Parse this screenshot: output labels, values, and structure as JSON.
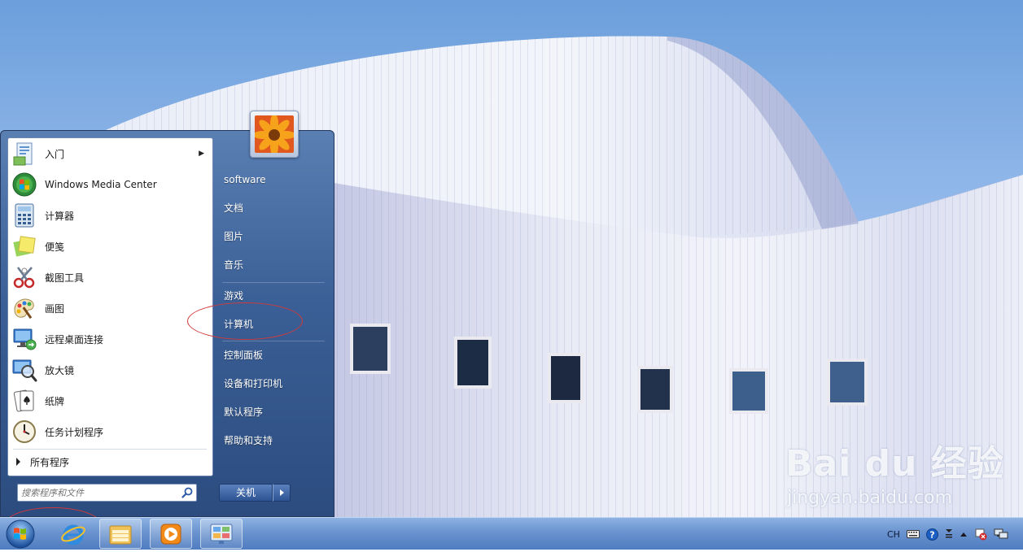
{
  "watermark": {
    "brand": "Bai du 经验",
    "url": "jingyan.baidu.com"
  },
  "start_menu": {
    "programs": [
      {
        "label": "入门",
        "icon": "getting-started-icon",
        "has_submenu": true
      },
      {
        "label": "Windows Media Center",
        "icon": "media-center-icon",
        "has_submenu": false
      },
      {
        "label": "计算器",
        "icon": "calculator-icon",
        "has_submenu": false
      },
      {
        "label": "便笺",
        "icon": "sticky-notes-icon",
        "has_submenu": false
      },
      {
        "label": "截图工具",
        "icon": "snipping-tool-icon",
        "has_submenu": false
      },
      {
        "label": "画图",
        "icon": "paint-icon",
        "has_submenu": false
      },
      {
        "label": "远程桌面连接",
        "icon": "remote-desktop-icon",
        "has_submenu": false
      },
      {
        "label": "放大镜",
        "icon": "magnifier-icon",
        "has_submenu": false
      },
      {
        "label": "纸牌",
        "icon": "solitaire-icon",
        "has_submenu": false
      },
      {
        "label": "任务计划程序",
        "icon": "task-scheduler-icon",
        "has_submenu": false
      }
    ],
    "all_programs": "所有程序",
    "search": {
      "placeholder": "搜索程序和文件",
      "value": ""
    },
    "right_items": [
      "software",
      "文档",
      "图片",
      "音乐",
      "游戏",
      "计算机",
      "控制面板",
      "设备和打印机",
      "默认程序",
      "帮助和支持"
    ],
    "shutdown_label": "关机"
  },
  "taskbar": {
    "pinned": [
      "internet-explorer-icon",
      "windows-explorer-icon",
      "media-player-icon",
      "control-panel-icon"
    ],
    "tray": {
      "language": "CH"
    }
  },
  "annotations": {
    "color": "#d13a3a"
  }
}
